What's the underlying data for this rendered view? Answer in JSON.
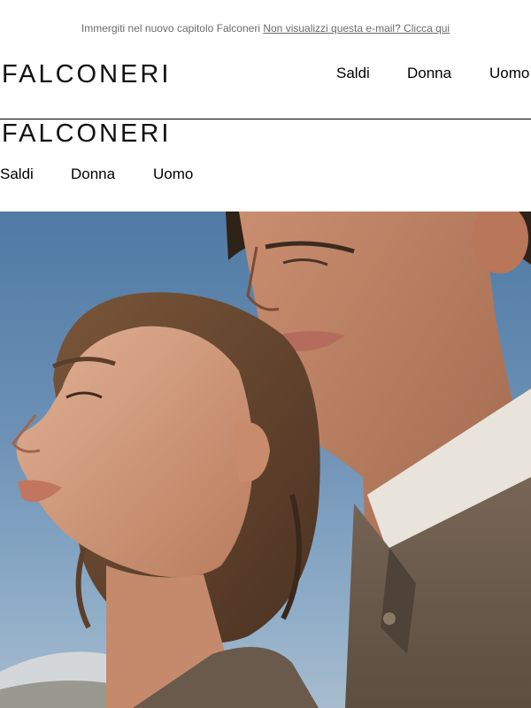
{
  "preheader": {
    "text": "Immergiti nel nuovo capitolo Falconeri",
    "link_text": "Non visualizzi questa e-mail? Clicca qui"
  },
  "header": {
    "logo": "FALCONERI",
    "nav": [
      "Saldi",
      "Donna",
      "Uomo"
    ]
  },
  "mobile_header": {
    "logo": "FALCONERI",
    "nav": [
      "Saldi",
      "Donna",
      "Uomo"
    ]
  },
  "hero": {
    "image_icon": "campaign-photo-couple",
    "colors": {
      "sky": "#5f86ae",
      "skin": "#d9a486",
      "hair": "#6a4a33",
      "sweater": "#6b5a4a"
    }
  }
}
